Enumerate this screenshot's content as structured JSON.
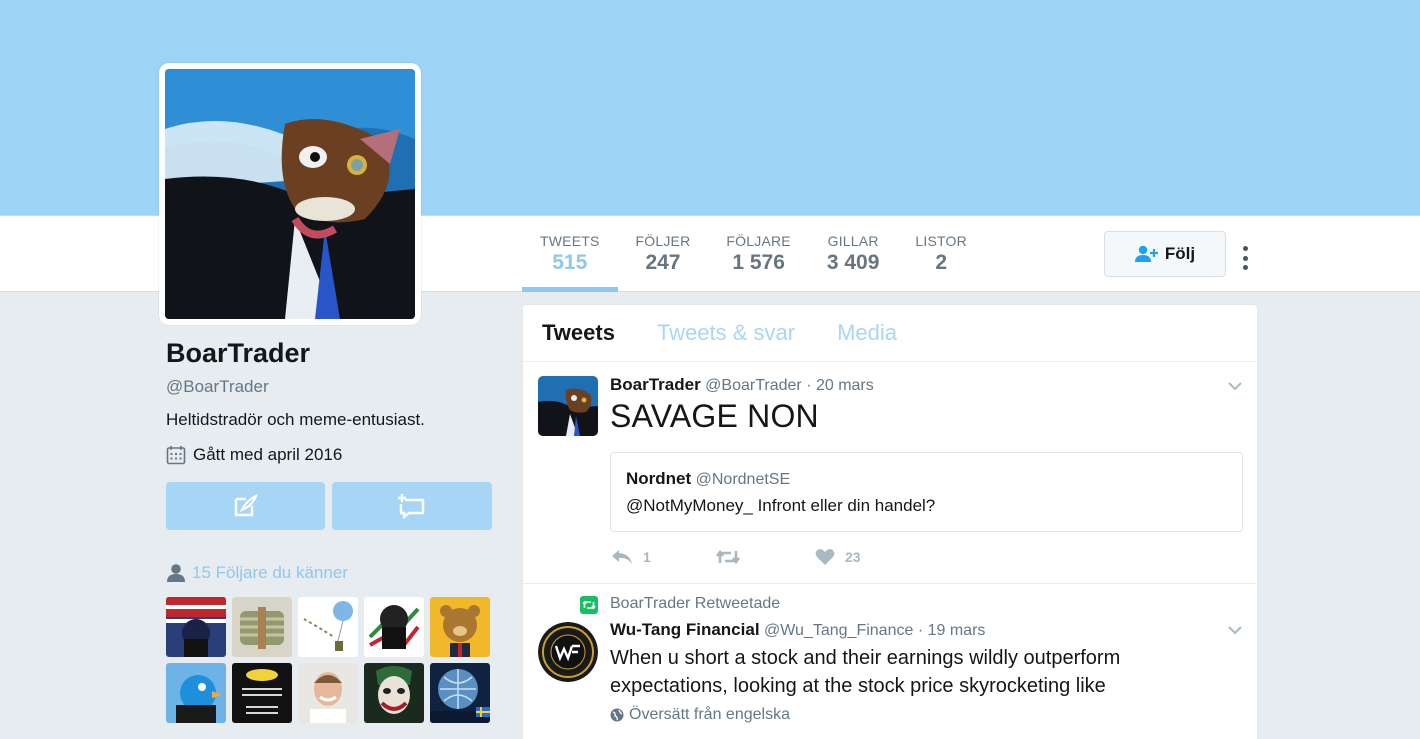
{
  "profile": {
    "name": "BoarTrader",
    "handle": "@BoarTrader",
    "bio": "Heltidstradör och meme-entusiast.",
    "joined": "Gått med april 2016"
  },
  "stats": [
    {
      "label": "TWEETS",
      "value": "515"
    },
    {
      "label": "FÖLJER",
      "value": "247"
    },
    {
      "label": "FÖLJARE",
      "value": "1 576"
    },
    {
      "label": "GILLAR",
      "value": "3 409"
    },
    {
      "label": "LISTOR",
      "value": "2"
    }
  ],
  "follow_label": "Följ",
  "followers_you_know": "15 Följare du känner",
  "tabs": [
    "Tweets",
    "Tweets & svar",
    "Media"
  ],
  "tweets": [
    {
      "name": "BoarTrader",
      "handle": "@BoarTrader",
      "date": "· 20 mars",
      "text": "SAVAGE NON",
      "quote": {
        "name": "Nordnet",
        "handle": "@NordnetSE",
        "text": "@NotMyMoney_ Infront eller din handel?"
      },
      "replies": "1",
      "retweets": "",
      "likes": "23"
    },
    {
      "retweeted_by": "BoarTrader Retweetade",
      "name": "Wu-Tang Financial",
      "handle": "@Wu_Tang_Finance",
      "date": "· 19 mars",
      "text_line1": "When u short a stock and their earnings wildly outperform",
      "text_line2": "expectations, looking at the stock price skyrocketing like",
      "translate": "Översätt från engelska"
    }
  ],
  "colors": {
    "banner": "#9dd3f7",
    "accent": "#8ec8ef",
    "button": "#a6d5f6"
  }
}
